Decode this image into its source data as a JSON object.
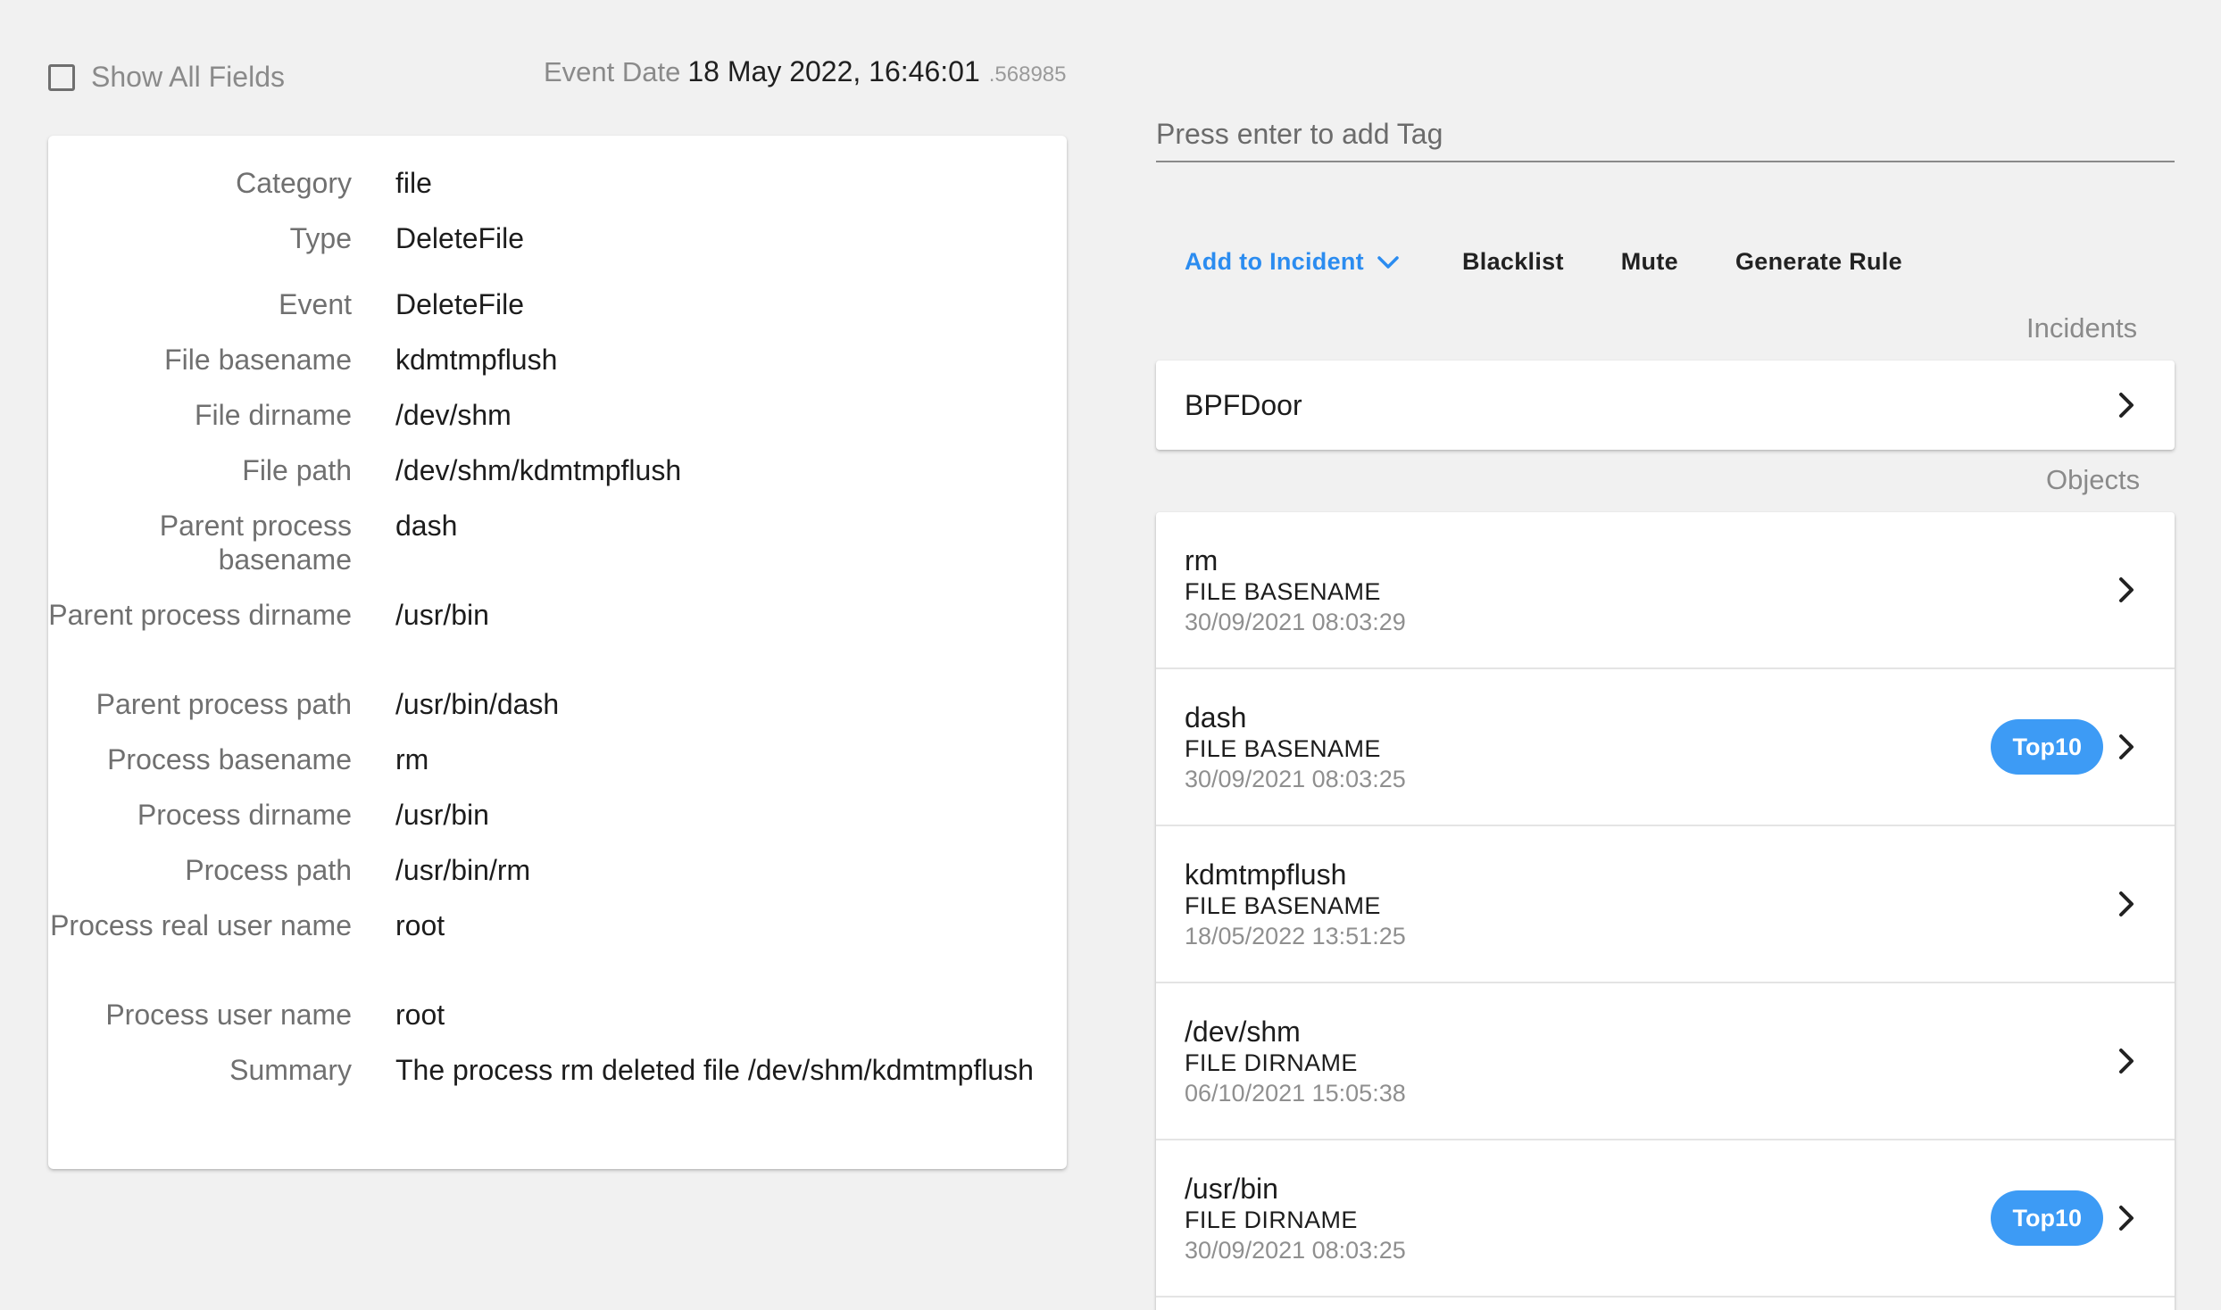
{
  "header": {
    "show_all_label": "Show All Fields",
    "event_date_label": "Event Date",
    "event_date_value": "18 May 2022, 16:46:01",
    "event_date_fraction": ".568985"
  },
  "fields": [
    {
      "key": "Category",
      "value": "file"
    },
    {
      "key": "Type",
      "value": "DeleteFile"
    },
    {
      "key": "Event",
      "value": "DeleteFile"
    },
    {
      "key": "File basename",
      "value": "kdmtmpflush"
    },
    {
      "key": "File dirname",
      "value": "/dev/shm"
    },
    {
      "key": "File path",
      "value": "/dev/shm/kdmtmpflush"
    },
    {
      "key": "Parent process basename",
      "value": "dash"
    },
    {
      "key": "Parent process dirname",
      "value": "/usr/bin"
    },
    {
      "key": "Parent process path",
      "value": "/usr/bin/dash"
    },
    {
      "key": "Process basename",
      "value": "rm"
    },
    {
      "key": "Process dirname",
      "value": "/usr/bin"
    },
    {
      "key": "Process path",
      "value": "/usr/bin/rm"
    },
    {
      "key": "Process real user name",
      "value": "root"
    },
    {
      "key": "Process user name",
      "value": "root"
    },
    {
      "key": "Summary",
      "value": "The process rm deleted file /dev/shm/kdmtmpflush"
    }
  ],
  "tag": {
    "placeholder": "Press enter to add Tag"
  },
  "actions": {
    "add_to_incident": "Add to Incident",
    "blacklist": "Blacklist",
    "mute": "Mute",
    "generate_rule": "Generate Rule"
  },
  "incidents": {
    "label": "Incidents",
    "items": [
      {
        "name": "BPFDoor"
      }
    ]
  },
  "objects": {
    "label": "Objects",
    "items": [
      {
        "name": "rm",
        "kind": "FILE BASENAME",
        "timestamp": "30/09/2021 08:03:29",
        "badge": ""
      },
      {
        "name": "dash",
        "kind": "FILE BASENAME",
        "timestamp": "30/09/2021 08:03:25",
        "badge": "Top10"
      },
      {
        "name": "kdmtmpflush",
        "kind": "FILE BASENAME",
        "timestamp": "18/05/2022 13:51:25",
        "badge": ""
      },
      {
        "name": "/dev/shm",
        "kind": "FILE DIRNAME",
        "timestamp": "06/10/2021 15:05:38",
        "badge": ""
      },
      {
        "name": "/usr/bin",
        "kind": "FILE DIRNAME",
        "timestamp": "30/09/2021 08:03:25",
        "badge": "Top10"
      }
    ]
  },
  "colors": {
    "accent": "#2b8cf0",
    "badge": "#3d9bf5",
    "background": "#f1f1f1"
  }
}
